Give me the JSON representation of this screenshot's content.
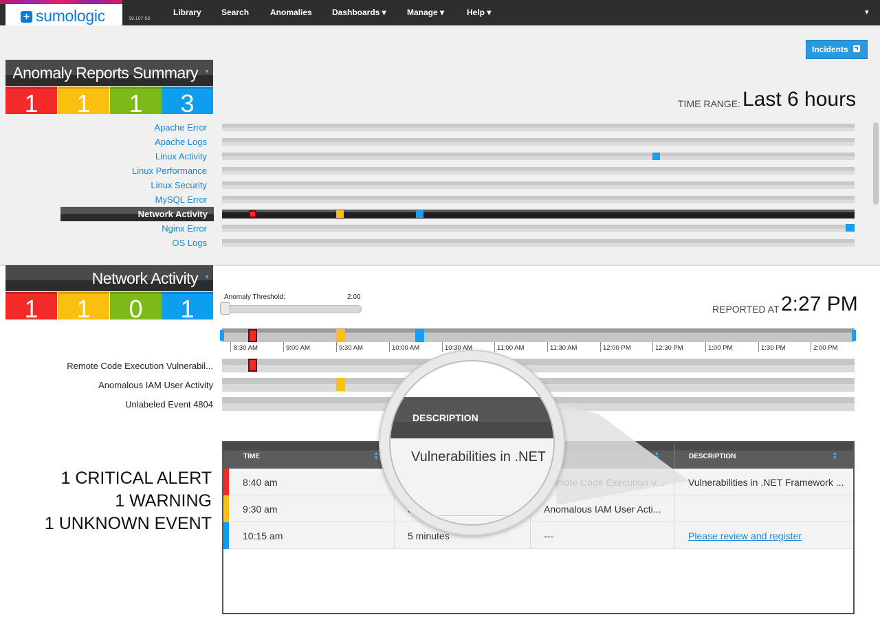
{
  "header": {
    "logo_text": "sumologic",
    "logo_icon": "plus-icon",
    "version": "19.107-50",
    "nav": [
      "Library",
      "Search",
      "Anomalies",
      "Dashboards ▾",
      "Manage ▾",
      "Help ▾"
    ],
    "user_menu": "▾"
  },
  "incidents_button": {
    "label": "Incidents",
    "icon": "external-link-icon"
  },
  "summary_panel": {
    "title": "Anomaly Reports Summary",
    "counts": [
      "1",
      "1",
      "1",
      "3"
    ],
    "count_colors": [
      "#f22a2a",
      "#fbbf0f",
      "#7cba1a",
      "#0d9ef0"
    ]
  },
  "time_range": {
    "label": "TIME RANGE:",
    "value": "Last 6 hours"
  },
  "sources": [
    "Apache Error",
    "Apache Logs",
    "Linux Activity",
    "Linux Performance",
    "Linux Security",
    "MySQL Error",
    "Network Activity",
    "Nginx Error",
    "OS Logs"
  ],
  "detail_panel": {
    "title": "Network Activity",
    "counts": [
      "1",
      "1",
      "0",
      "1"
    ]
  },
  "threshold": {
    "label": "Anomaly Threshold:",
    "value": "2.00"
  },
  "reported": {
    "label": "REPORTED AT",
    "value": "2:27 PM"
  },
  "timeline_ticks": [
    "8:30 AM",
    "9:00 AM",
    "9:30 AM",
    "10:00 AM",
    "10:30 AM",
    "11:00 AM",
    "11:30 AM",
    "12:00 PM",
    "12:30 PM",
    "1:00 PM",
    "1:30 PM",
    "2:00 PM"
  ],
  "events": [
    "Remote Code Execution Vulnerabil...",
    "Anomalous IAM User Activity",
    "Unlabeled Event 4804"
  ],
  "summary_lines": [
    "1 CRITICAL ALERT",
    "1 WARNING",
    "1 UNKNOWN EVENT"
  ],
  "table": {
    "columns": [
      "TIME",
      "",
      "",
      "DESCRIPTION"
    ],
    "rows": [
      {
        "time": "8:40 am",
        "duration": "",
        "name": "Remote Code Execution V...",
        "description": "Vulnerabilities in .NET Framework ...",
        "color": "#f22a2a"
      },
      {
        "time": "9:30 am",
        "duration": "5",
        "name": "Anomalous IAM User Acti...",
        "description": "",
        "color": "#fbbf0f"
      },
      {
        "time": "10:15 am",
        "duration": "5 minutes",
        "name": "---",
        "description": "Please review and register",
        "color": "#1a9ef0"
      }
    ]
  },
  "magnifier": {
    "header": "DESCRIPTION",
    "value": "Vulnerabilities in .NET"
  }
}
